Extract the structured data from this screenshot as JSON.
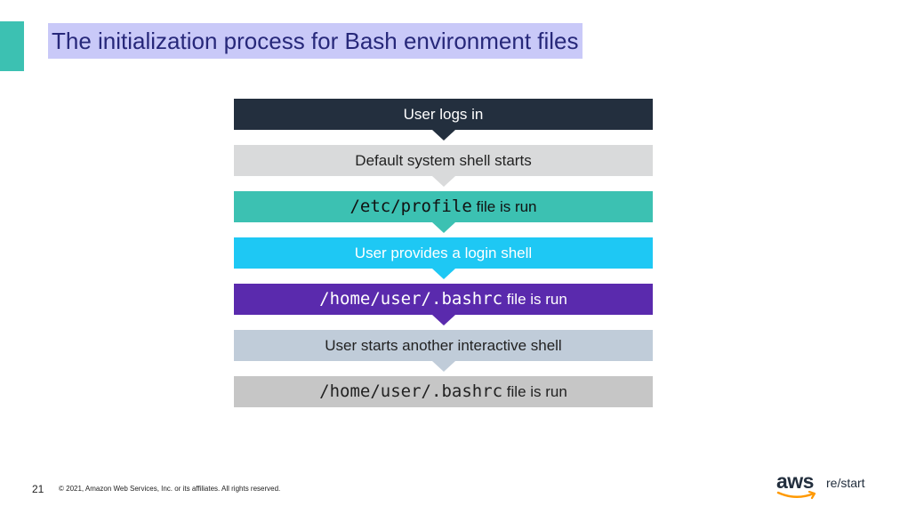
{
  "slide": {
    "title": "The initialization process for Bash environment files",
    "page_number": "21",
    "copyright": "© 2021, Amazon Web Services, Inc. or its affiliates. All rights reserved.",
    "logo_text": "aws",
    "logo_suffix": "re/start"
  },
  "flow": {
    "steps": [
      {
        "code": "",
        "text": "User logs in",
        "color": "#232f3e"
      },
      {
        "code": "",
        "text": "Default system shell starts",
        "color": "#d9dadb"
      },
      {
        "code": "/etc/profile",
        "text": " file is run",
        "color": "#3cc1b2"
      },
      {
        "code": "",
        "text": "User provides a login shell",
        "color": "#1ec8f4"
      },
      {
        "code": "/home/user/.bashrc",
        "text": " file is run",
        "color": "#5a2aad"
      },
      {
        "code": "",
        "text": "User starts another interactive shell",
        "color": "#c0ccd9"
      },
      {
        "code": "/home/user/.bashrc",
        "text": " file is run",
        "color": "#c6c6c6"
      }
    ]
  },
  "colors": {
    "accent": "#3cc1b2",
    "title_text": "#27287a",
    "title_highlight": "#c9c9f8",
    "aws_smile": "#ff9900"
  }
}
